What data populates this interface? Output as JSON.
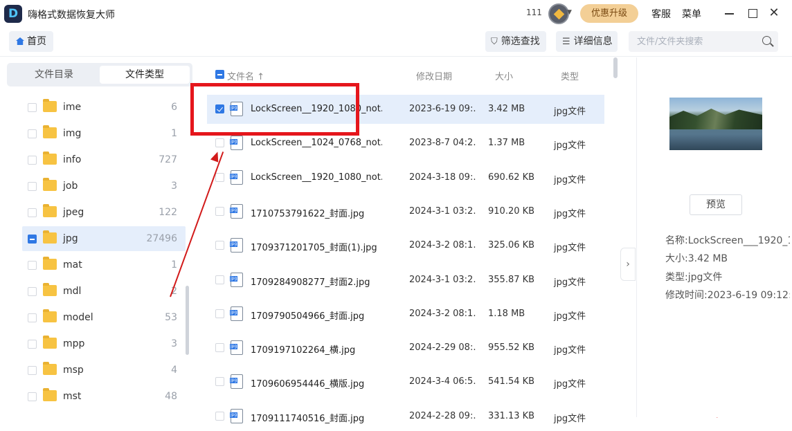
{
  "app": {
    "title": "嗨格式数据恢复大师",
    "logo_letter": "D",
    "user_id": "111",
    "upgrade_label": "优惠升级",
    "support_label": "客服",
    "menu_label": "菜单",
    "close_glyph": "✕"
  },
  "toolbar": {
    "home_label": "首页",
    "filter_label": "筛选查找",
    "detail_label": "详细信息",
    "search_placeholder": "文件/文件夹搜索",
    "filter_icon_glyph": "⛉",
    "detail_icon_glyph": "☰"
  },
  "sidebar": {
    "tabs": [
      "文件目录",
      "文件类型"
    ],
    "active_tab": "文件类型",
    "items": [
      {
        "name": "ime",
        "count": "6"
      },
      {
        "name": "img",
        "count": "1"
      },
      {
        "name": "info",
        "count": "727"
      },
      {
        "name": "job",
        "count": "3"
      },
      {
        "name": "jpeg",
        "count": "122"
      },
      {
        "name": "jpg",
        "count": "27496"
      },
      {
        "name": "mat",
        "count": "1"
      },
      {
        "name": "mdl",
        "count": "2"
      },
      {
        "name": "model",
        "count": "53"
      },
      {
        "name": "mpp",
        "count": "3"
      },
      {
        "name": "msp",
        "count": "4"
      },
      {
        "name": "mst",
        "count": "48"
      }
    ],
    "selected_item": "jpg"
  },
  "file_list": {
    "headers": {
      "name": "文件名",
      "sort_glyph": "↑",
      "date": "修改日期",
      "size": "大小",
      "type": "类型"
    },
    "rows": [
      {
        "name": "LockScreen__1920_1080_not...",
        "date": "2023-6-19 09:...",
        "size": "3.42 MB",
        "type": "jpg文件",
        "checked": true
      },
      {
        "name": "LockScreen__1024_0768_not...",
        "date": "2023-8-7 04:2...",
        "size": "1.37 MB",
        "type": "jpg文件",
        "checked": false
      },
      {
        "name": "LockScreen__1920_1080_not...",
        "date": "2024-3-18 09:...",
        "size": "690.62 KB",
        "type": "jpg文件",
        "checked": false
      },
      {
        "name": "1710753791622_封面.jpg",
        "date": "2024-3-1 03:2...",
        "size": "910.20 KB",
        "type": "jpg文件",
        "checked": false
      },
      {
        "name": "1709371201705_封面(1).jpg",
        "date": "2024-3-2 08:1...",
        "size": "325.06 KB",
        "type": "jpg文件",
        "checked": false
      },
      {
        "name": "1709284908277_封面2.jpg",
        "date": "2024-3-1 03:2...",
        "size": "355.87 KB",
        "type": "jpg文件",
        "checked": false
      },
      {
        "name": "1709790504966_封面.jpg",
        "date": "2024-3-2 08:1...",
        "size": "1.18 MB",
        "type": "jpg文件",
        "checked": false
      },
      {
        "name": "1709197102264_横.jpg",
        "date": "2024-2-29 08:...",
        "size": "955.52 KB",
        "type": "jpg文件",
        "checked": false
      },
      {
        "name": "1709606954446_横版.jpg",
        "date": "2024-3-4 06:5...",
        "size": "541.54 KB",
        "type": "jpg文件",
        "checked": false
      },
      {
        "name": "1709111740516_封面.jpg",
        "date": "2024-2-28 09:...",
        "size": "331.13 KB",
        "type": "jpg文件",
        "checked": false
      }
    ]
  },
  "detail_panel": {
    "preview_label": "预览",
    "collapse_glyph": "›",
    "name_line": "名称:LockScreen___1920_1...",
    "size_line": "大小:3.42 MB",
    "type_line": "类型:jpg文件",
    "mtime_line": "修改时间:2023-6-19 09:12:..."
  },
  "colors": {
    "accent": "#2f78e4",
    "selection_bg": "#e5eefb",
    "upgrade_bg": "#f3cf96",
    "annotation": "#e5161c"
  }
}
